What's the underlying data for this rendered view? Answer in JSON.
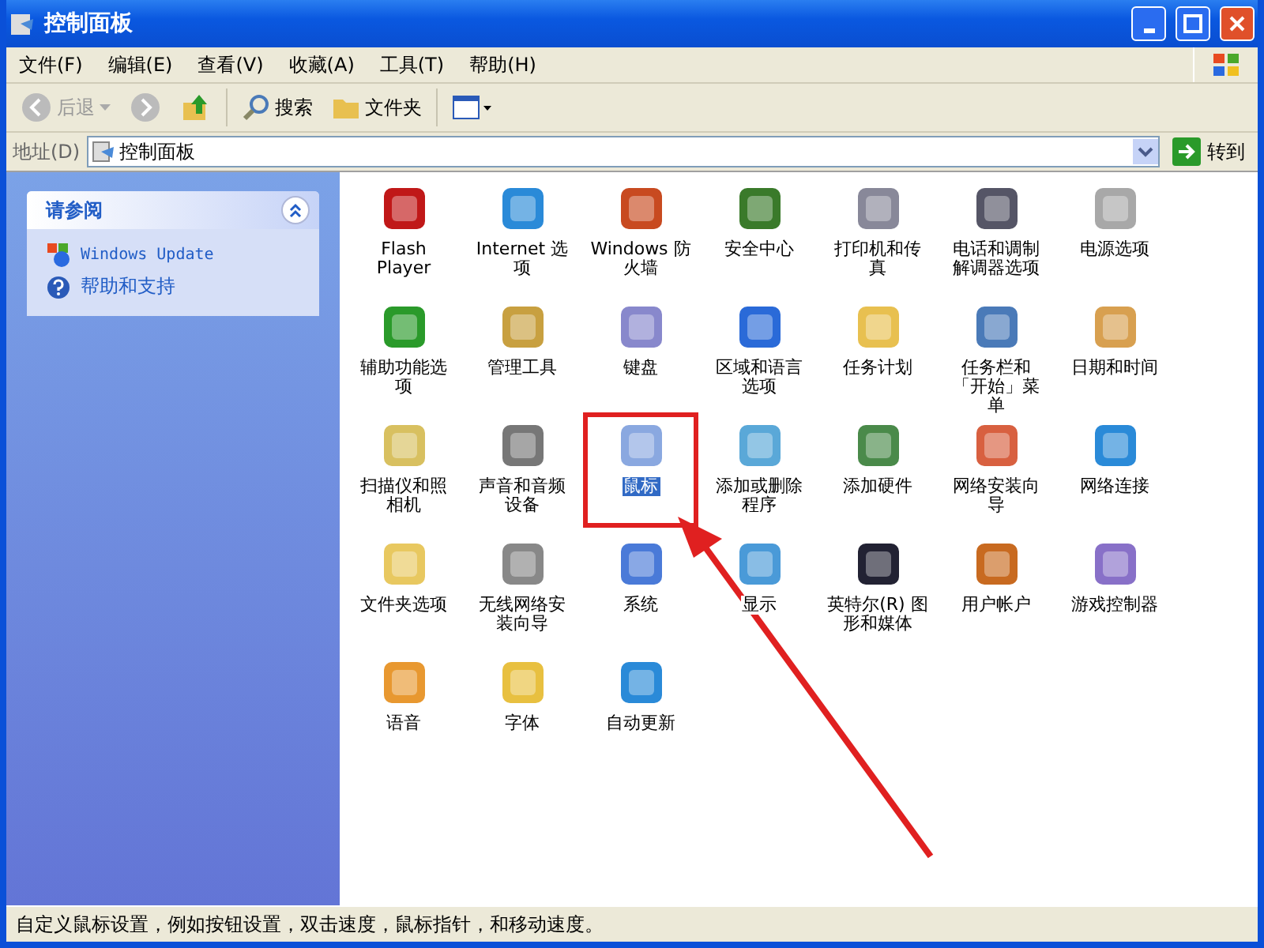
{
  "window": {
    "title": "控制面板"
  },
  "menu": [
    "文件(F)",
    "编辑(E)",
    "查看(V)",
    "收藏(A)",
    "工具(T)",
    "帮助(H)"
  ],
  "toolbar": {
    "back": "后退",
    "search": "搜索",
    "folders": "文件夹"
  },
  "address": {
    "label": "地址(D)",
    "value": "控制面板",
    "go": "转到"
  },
  "sidebar": {
    "title": "请参阅",
    "expanded": true,
    "links": [
      "Windows Update",
      "帮助和支持"
    ]
  },
  "items": [
    {
      "label": "Flash Player",
      "selected": false,
      "highlighted": false
    },
    {
      "label": "Internet 选项",
      "selected": false,
      "highlighted": false
    },
    {
      "label": "Windows 防火墙",
      "selected": false,
      "highlighted": false
    },
    {
      "label": "安全中心",
      "selected": false,
      "highlighted": false
    },
    {
      "label": "打印机和传真",
      "selected": false,
      "highlighted": false
    },
    {
      "label": "电话和调制解调器选项",
      "selected": false,
      "highlighted": false
    },
    {
      "label": "电源选项",
      "selected": false,
      "highlighted": false
    },
    {
      "label": "辅助功能选项",
      "selected": false,
      "highlighted": false
    },
    {
      "label": "管理工具",
      "selected": false,
      "highlighted": false
    },
    {
      "label": "键盘",
      "selected": false,
      "highlighted": false
    },
    {
      "label": "区域和语言选项",
      "selected": false,
      "highlighted": false
    },
    {
      "label": "任务计划",
      "selected": false,
      "highlighted": false
    },
    {
      "label": "任务栏和「开始」菜单",
      "selected": false,
      "highlighted": false
    },
    {
      "label": "日期和时间",
      "selected": false,
      "highlighted": false
    },
    {
      "label": "扫描仪和照相机",
      "selected": false,
      "highlighted": false
    },
    {
      "label": "声音和音频设备",
      "selected": false,
      "highlighted": false
    },
    {
      "label": "鼠标",
      "selected": true,
      "highlighted": true
    },
    {
      "label": "添加或删除程序",
      "selected": false,
      "highlighted": false
    },
    {
      "label": "添加硬件",
      "selected": false,
      "highlighted": false
    },
    {
      "label": "网络安装向导",
      "selected": false,
      "highlighted": false
    },
    {
      "label": "网络连接",
      "selected": false,
      "highlighted": false
    },
    {
      "label": "文件夹选项",
      "selected": false,
      "highlighted": false
    },
    {
      "label": "无线网络安装向导",
      "selected": false,
      "highlighted": false
    },
    {
      "label": "系统",
      "selected": false,
      "highlighted": false
    },
    {
      "label": "显示",
      "selected": false,
      "highlighted": false
    },
    {
      "label": "英特尔(R) 图形和媒体",
      "selected": false,
      "highlighted": false
    },
    {
      "label": "用户帐户",
      "selected": false,
      "highlighted": false
    },
    {
      "label": "游戏控制器",
      "selected": false,
      "highlighted": false
    },
    {
      "label": "语音",
      "selected": false,
      "highlighted": false
    },
    {
      "label": "字体",
      "selected": false,
      "highlighted": false
    },
    {
      "label": "自动更新",
      "selected": false,
      "highlighted": false
    }
  ],
  "status_bar": "自定义鼠标设置，例如按钮设置，双击速度，鼠标指针，和移动速度。"
}
